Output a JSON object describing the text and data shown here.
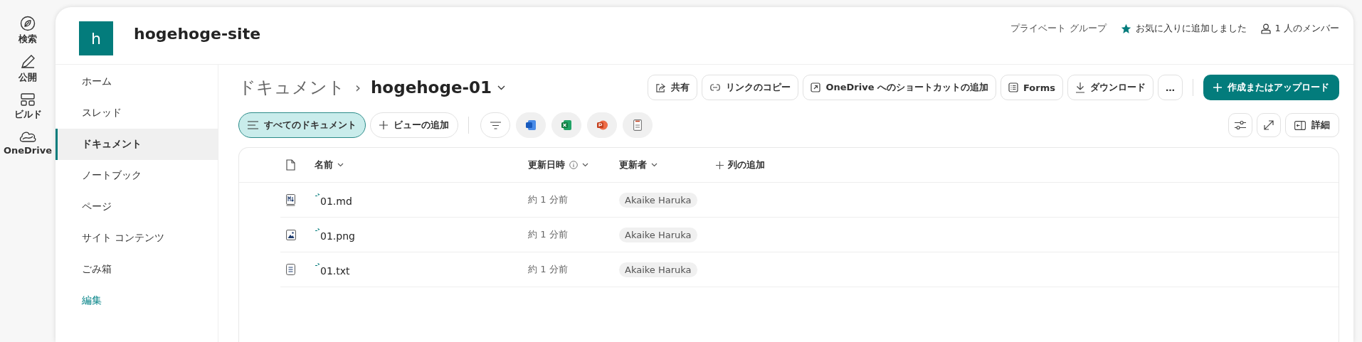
{
  "rail": [
    {
      "label": "検索"
    },
    {
      "label": "公開"
    },
    {
      "label": "ビルド"
    },
    {
      "label": "OneDrive"
    }
  ],
  "site": {
    "logo_letter": "h",
    "title": "hogehoge-site",
    "privacy": "プライベート グループ",
    "favorite": "お気に入りに追加しました",
    "members": "1 人のメンバー"
  },
  "nav": [
    {
      "label": "ホーム",
      "selected": false
    },
    {
      "label": "スレッド",
      "selected": false
    },
    {
      "label": "ドキュメント",
      "selected": true
    },
    {
      "label": "ノートブック",
      "selected": false
    },
    {
      "label": "ページ",
      "selected": false
    },
    {
      "label": "サイト コンテンツ",
      "selected": false
    },
    {
      "label": "ごみ箱",
      "selected": false
    }
  ],
  "nav_edit": "編集",
  "breadcrumb": {
    "parent": "ドキュメント",
    "separator": "›",
    "current": "hogehoge-01"
  },
  "commands": [
    {
      "label": "共有"
    },
    {
      "label": "リンクのコピー"
    },
    {
      "label": "OneDrive へのショートカットの追加"
    },
    {
      "label": "Forms"
    },
    {
      "label": "ダウンロード"
    },
    {
      "label": "…"
    }
  ],
  "primary_button": "作成またはアップロード",
  "views": [
    {
      "label": "すべてのドキュメント",
      "selected": true
    },
    {
      "label": "ビューの追加",
      "selected": false
    }
  ],
  "details_button": "詳細",
  "table": {
    "columns": [
      "名前",
      "更新日時",
      "更新者",
      "列の追加"
    ],
    "rows": [
      {
        "kind": "markdown",
        "name": "01.md",
        "new": true,
        "modified": "約 1 分前",
        "modified_by": "Akaike Haruka"
      },
      {
        "kind": "image",
        "name": "01.png",
        "new": true,
        "modified": "約 1 分前",
        "modified_by": "Akaike Haruka"
      },
      {
        "kind": "text",
        "name": "01.txt",
        "new": true,
        "modified": "約 1 分前",
        "modified_by": "Akaike Haruka"
      }
    ]
  }
}
